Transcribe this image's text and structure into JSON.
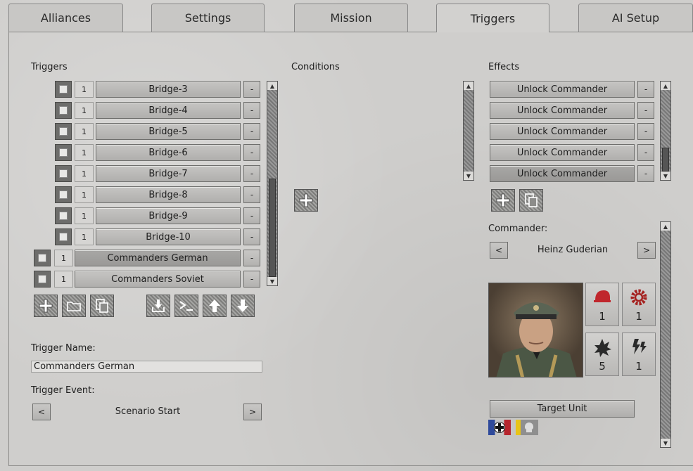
{
  "tabs": [
    {
      "label": "Alliances",
      "active": false
    },
    {
      "label": "Settings",
      "active": false
    },
    {
      "label": "Mission",
      "active": false
    },
    {
      "label": "Triggers",
      "active": true
    },
    {
      "label": "AI Setup",
      "active": false
    }
  ],
  "triggers": {
    "heading": "Triggers",
    "rows": [
      {
        "count": "1",
        "name": "Bridge-3",
        "remove": "-"
      },
      {
        "count": "1",
        "name": "Bridge-4",
        "remove": "-"
      },
      {
        "count": "1",
        "name": "Bridge-5",
        "remove": "-"
      },
      {
        "count": "1",
        "name": "Bridge-6",
        "remove": "-"
      },
      {
        "count": "1",
        "name": "Bridge-7",
        "remove": "-"
      },
      {
        "count": "1",
        "name": "Bridge-8",
        "remove": "-"
      },
      {
        "count": "1",
        "name": "Bridge-9",
        "remove": "-"
      },
      {
        "count": "1",
        "name": "Bridge-10",
        "remove": "-"
      },
      {
        "count": "1",
        "name": "Commanders German",
        "remove": "-",
        "selected": true
      },
      {
        "count": "1",
        "name": "Commanders Soviet",
        "remove": "-"
      }
    ],
    "toolbar": [
      "add-icon",
      "folder-icon",
      "copy-icon",
      "import-icon",
      "console-icon",
      "arrow-up-icon",
      "arrow-down-icon"
    ]
  },
  "trigger_name": {
    "label": "Trigger Name:",
    "value": "Commanders German"
  },
  "trigger_event": {
    "label": "Trigger Event:",
    "value": "Scenario Start",
    "prev": "<",
    "next": ">"
  },
  "conditions": {
    "heading": "Conditions"
  },
  "effects": {
    "heading": "Effects",
    "rows": [
      {
        "name": "Unlock Commander",
        "remove": "-"
      },
      {
        "name": "Unlock Commander",
        "remove": "-"
      },
      {
        "name": "Unlock Commander",
        "remove": "-"
      },
      {
        "name": "Unlock Commander",
        "remove": "-"
      },
      {
        "name": "Unlock Commander",
        "remove": "-",
        "selected": true
      }
    ]
  },
  "commander": {
    "label": "Commander:",
    "name": "Heinz Guderian",
    "prev": "<",
    "next": ">",
    "stats": [
      {
        "icon": "helmet-icon",
        "value": "1",
        "color": "#c0262c"
      },
      {
        "icon": "gear-icon",
        "value": "1",
        "color": "#a5211f"
      },
      {
        "icon": "explosion-icon",
        "value": "5",
        "color": "#2a2a2a"
      },
      {
        "icon": "lightning-icon",
        "value": "1",
        "color": "#2a2a2a"
      }
    ],
    "target_button": "Target Unit",
    "flags": [
      "german-cross-flag",
      "axis-skull-flag"
    ]
  }
}
